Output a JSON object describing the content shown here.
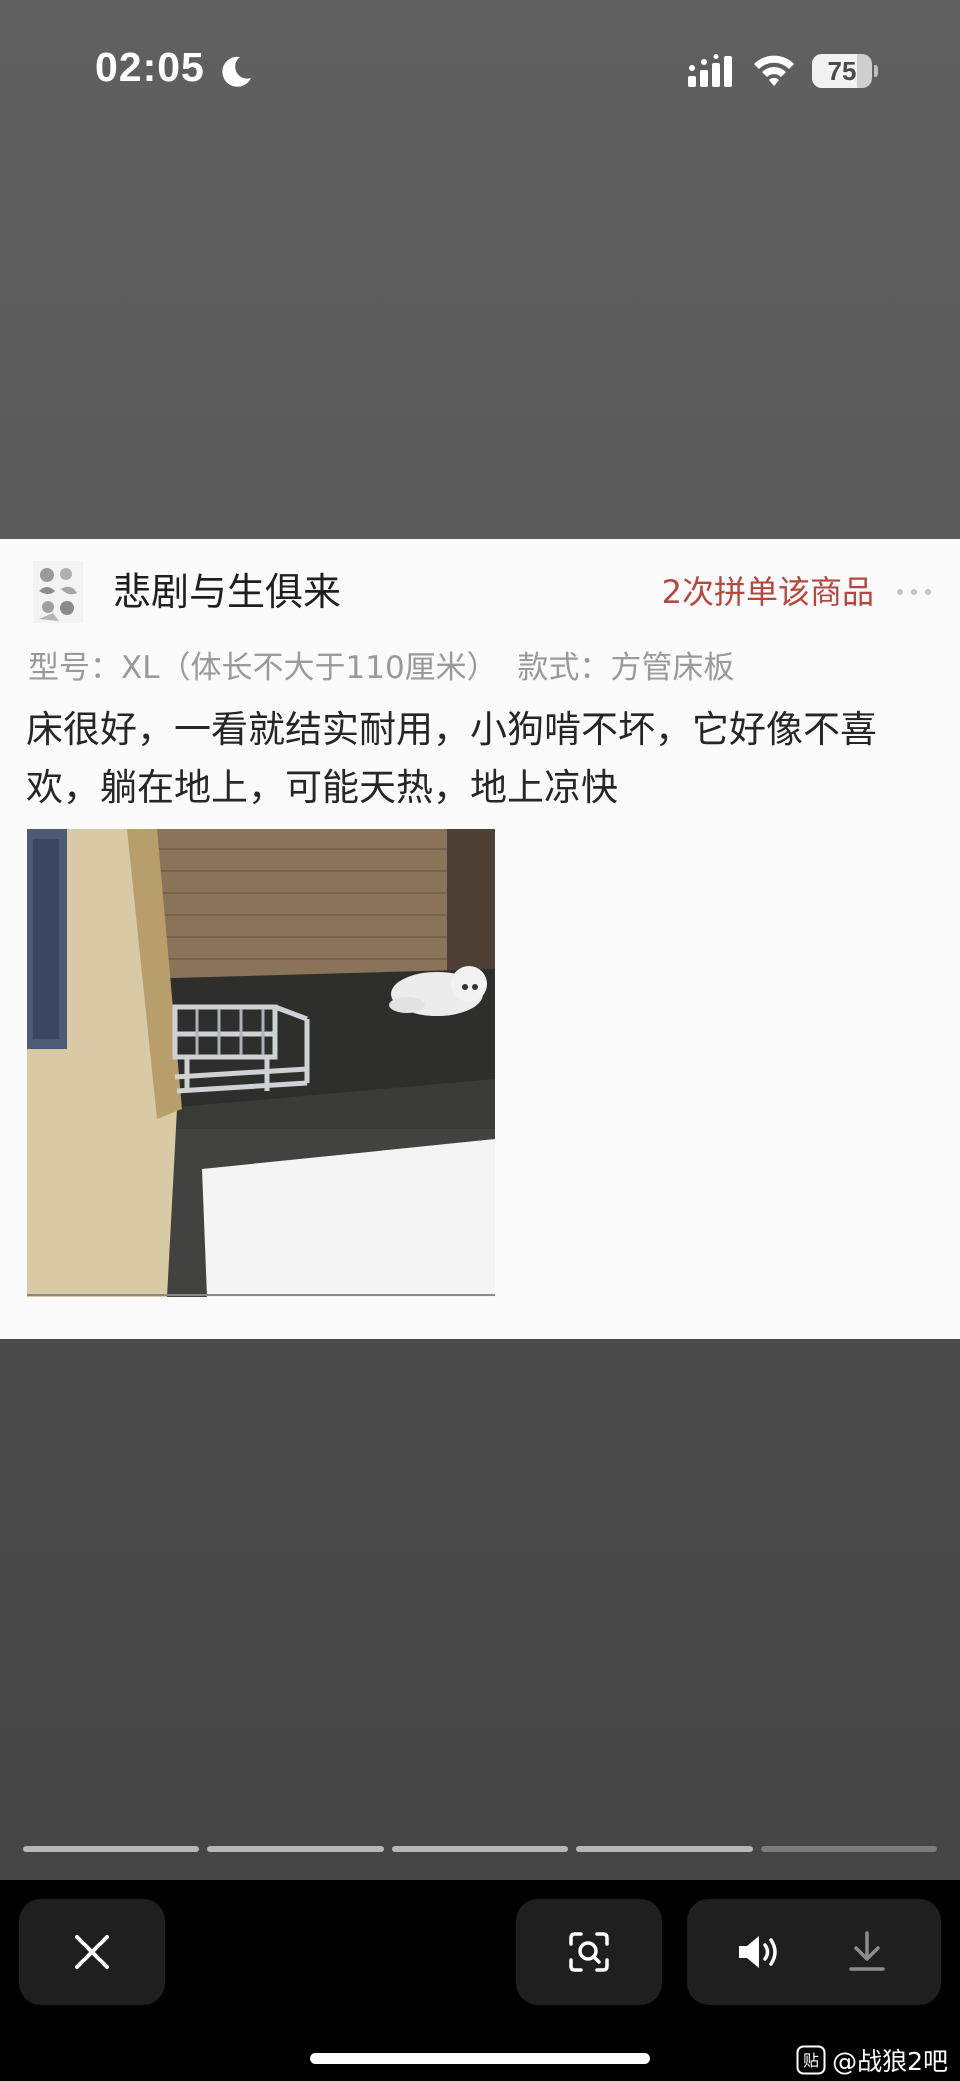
{
  "status_bar": {
    "time": "02:05",
    "battery": "75",
    "battery_level": 0.75
  },
  "review": {
    "username": "悲剧与生俱来",
    "purchase_badge": "2次拼单该商品",
    "spec": "型号：XL（体长不大于110厘米）  款式：方管床板",
    "text": "床很好，一看就结实耐用，小狗啃不坏，它好像不喜欢，躺在地上，可能天热，地上凉快"
  },
  "viewer": {
    "progress_total": 5,
    "progress_current": 5
  },
  "watermark": {
    "text": "@战狼2吧",
    "logo_glyph": "贴"
  },
  "colors": {
    "badge": "#b5473e",
    "toolbar": "#000000",
    "button": "#1f1f1f"
  }
}
